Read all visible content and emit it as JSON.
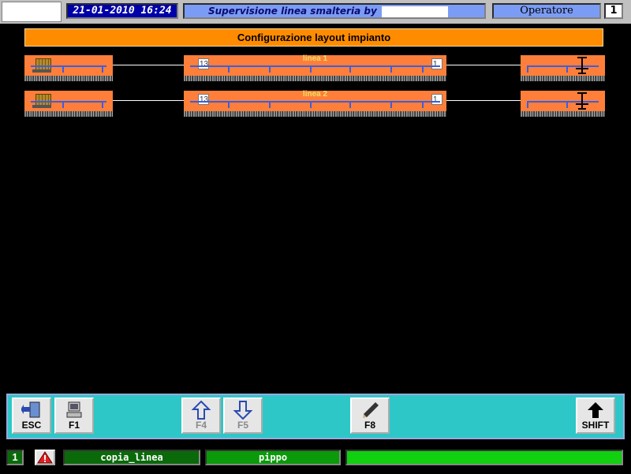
{
  "header": {
    "datetime": "21-01-2010 16:24",
    "system_name": "Supervisione linea smalteria by",
    "user_role": "Operatore",
    "operator_number": "1"
  },
  "title": "Configurazione layout impianto",
  "lines": [
    {
      "label": "linea 1",
      "counter_left": "13",
      "counter_right": "1"
    },
    {
      "label": "linea 2",
      "counter_left": "13",
      "counter_right": "1"
    }
  ],
  "function_keys": [
    {
      "key": "ESC",
      "icon": "exit-door-icon",
      "enabled": true
    },
    {
      "key": "F1",
      "icon": "computer-icon",
      "enabled": true
    },
    {
      "key": "F4",
      "icon": "arrow-up-icon",
      "enabled": false
    },
    {
      "key": "F5",
      "icon": "arrow-down-icon",
      "enabled": false
    },
    {
      "key": "F8",
      "icon": "pencil-icon",
      "enabled": true
    },
    {
      "key": "SHIFT",
      "icon": "shift-arrow-icon",
      "enabled": true
    }
  ],
  "status": {
    "number": "1",
    "warning_icon": "warning-triangle-icon",
    "function": "copia_linea",
    "user": "pippo",
    "message": ""
  },
  "colors": {
    "title_bg": "#ff8c00",
    "segment": "#ff7f3a",
    "fkbar": "#2ec7c7",
    "status_green": "#10d010"
  }
}
